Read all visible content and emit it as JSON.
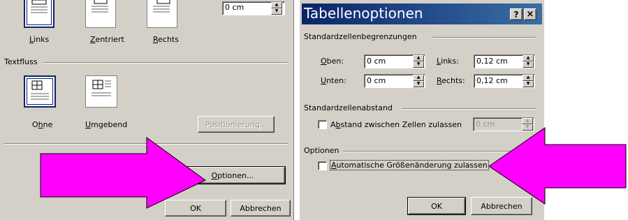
{
  "left_dialog": {
    "alignment": {
      "options": [
        {
          "label_pre": "",
          "label_ul": "L",
          "label_post": "inks"
        },
        {
          "label_pre": "",
          "label_ul": "Z",
          "label_post": "entriert"
        },
        {
          "label_pre": "",
          "label_ul": "R",
          "label_post": "echts"
        }
      ],
      "indent_value": "0 cm"
    },
    "text_flow": {
      "title": "Textfluss",
      "options": [
        {
          "label_pre": "O",
          "label_ul": "h",
          "label_post": "ne"
        },
        {
          "label_pre": "",
          "label_ul": "U",
          "label_post": "mgebend"
        }
      ],
      "positioning_label": "Positionierung..."
    },
    "options_button": {
      "label_pre": "",
      "label_ul": "O",
      "label_post": "ptionen..."
    },
    "ok_label": "OK",
    "cancel_label": "Abbrechen"
  },
  "right_dialog": {
    "title": "Tabellenoptionen",
    "help_label": "?",
    "close_label": "×",
    "margins_group": {
      "title": "Standardzellenbegrenzungen",
      "top": {
        "label_ul": "O",
        "label_post": "ben:",
        "value": "0 cm"
      },
      "bottom": {
        "label_ul": "U",
        "label_post": "nten:",
        "value": "0 cm"
      },
      "left": {
        "label_ul": "L",
        "label_post": "inks:",
        "value": "0,12 cm"
      },
      "right": {
        "label_ul": "R",
        "label_post": "echts:",
        "value": "0,12 cm"
      }
    },
    "spacing_group": {
      "title": "Standardzellenabstand",
      "checkbox_pre": "A",
      "checkbox_ul": "b",
      "checkbox_post": "stand zwischen Zellen zulassen",
      "value": "0 cm"
    },
    "options_group": {
      "title": "Optionen",
      "checkbox_ul": "A",
      "checkbox_post": "utomatische Größenänderung zulassen"
    },
    "ok_label": "OK",
    "cancel_label": "Abbrechen"
  },
  "colors": {
    "dialog_bg": "#d4d0c8",
    "title_bar": "#0a246a",
    "arrow": "#ff00ff"
  }
}
